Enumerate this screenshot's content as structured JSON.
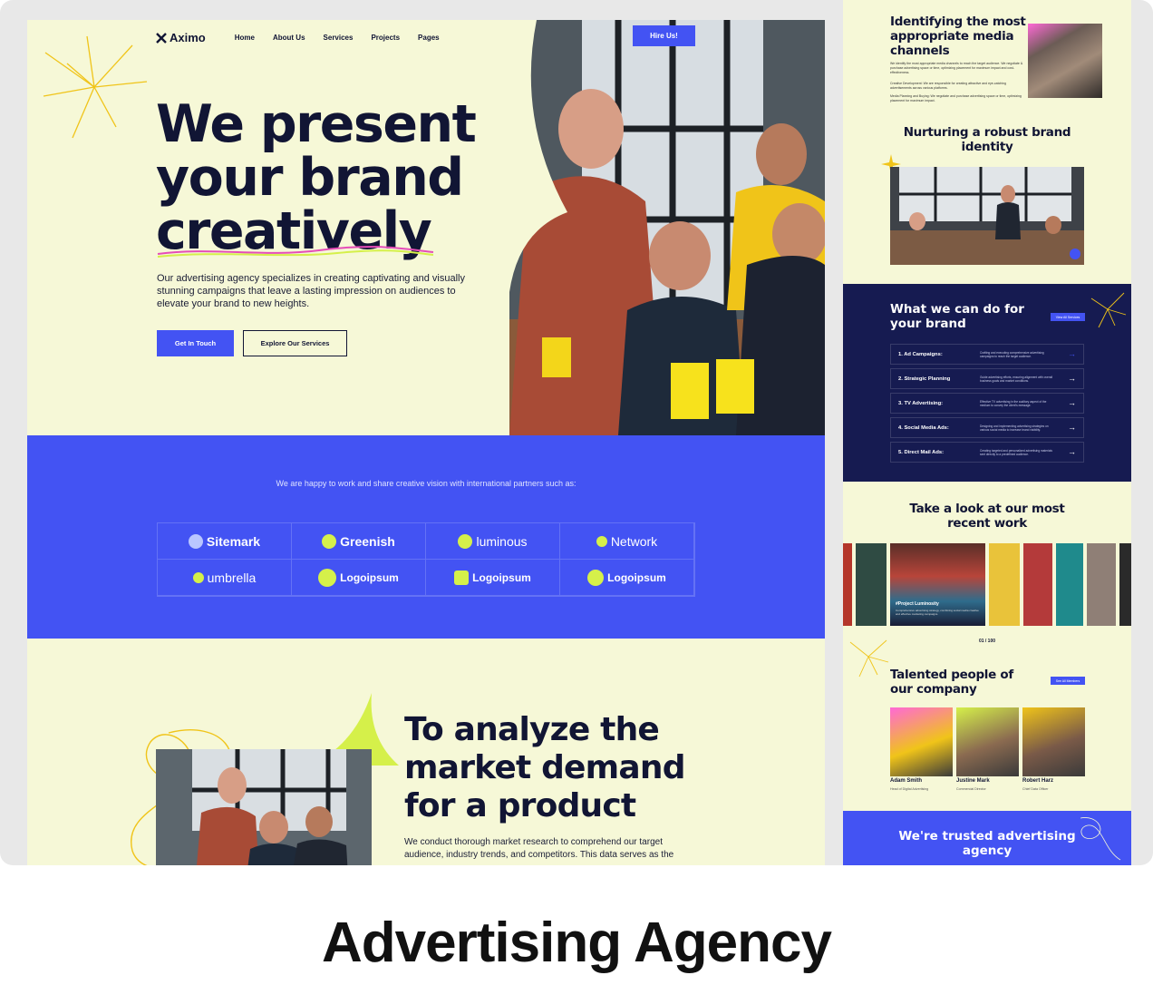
{
  "caption": "Advertising Agency",
  "main": {
    "logo": "Aximo",
    "nav": [
      "Home",
      "About Us",
      "Services",
      "Projects",
      "Pages"
    ],
    "hire_button": "Hire Us!",
    "hero": {
      "title_lines": [
        "We present",
        "your brand",
        "creatively"
      ],
      "description": "Our advertising agency specializes in creating captivating and visually stunning campaigns that leave a lasting impression on audiences to elevate your brand to new heights.",
      "primary_button": "Get In Touch",
      "secondary_button": "Explore Our Services"
    },
    "partners": {
      "text": "We are happy to work and share creative vision with international partners such as:",
      "logos": [
        "Sitemark",
        "Greenish",
        "luminous",
        "Network",
        "umbrella",
        "Logoipsum",
        "Logoipsum",
        "Logoipsum"
      ]
    },
    "section2": {
      "title_lines": [
        "To analyze the",
        "market demand",
        "for a product"
      ],
      "description": "We conduct thorough market research to comprehend our target audience, industry trends, and competitors. This data serves as the"
    }
  },
  "side": {
    "media": {
      "title": "Identifying the most appropriate media channels",
      "description": "We identify the most appropriate media channels to reach the target audience. We negotiate & purchase advertising space or time, optimizing placement for maximum impact and cost-effectiveness.",
      "bullets": [
        "Creative Development: We are responsible for creating attractive and eye-catching advertisements across various platforms.",
        "Media Planning and Buying: We negotiate and purchase advertising space or time, optimizing placement for maximum impact."
      ]
    },
    "identity": {
      "title": "Nurturing a robust brand identity"
    },
    "services": {
      "title": "What we can do for your brand",
      "button": "View All Services",
      "items": [
        {
          "title": "1. Ad Campaigns:",
          "desc": "Crafting and executing comprehensive advertising campaigns to reach the target audience."
        },
        {
          "title": "2. Strategic Planning",
          "desc": "Guide advertising efforts, ensuring alignment with overall business goals and market conditions."
        },
        {
          "title": "3. TV Advertising:",
          "desc": "Effective TV advertising in the auditory aspect of the medium to convey the client's message."
        },
        {
          "title": "4. Social Media Ads:",
          "desc": "Designing and implementing advertising strategies on various social media to increase brand visibility."
        },
        {
          "title": "5. Direct Mail Ads:",
          "desc": "Creating targeted and personalized advertising materials sent directly to a predefined audience."
        }
      ],
      "arrow": "→"
    },
    "work": {
      "title": "Take a look at our most recent work",
      "project_label": "#Project Luminosity",
      "project_desc": "Comprehensive advertising strategy, combining social media creative and effective marketing campaigns.",
      "counter": "01 / 100"
    },
    "team": {
      "title": "Talented people of our company",
      "button": "See All Members",
      "members": [
        {
          "name": "Adam Smith",
          "role": "Head of Digital Advertising"
        },
        {
          "name": "Justine Mark",
          "role": "Commercial Director"
        },
        {
          "name": "Robert Harz",
          "role": "Chief Data Officer"
        }
      ]
    },
    "trusted": {
      "title": "We're trusted advertising agency"
    }
  }
}
